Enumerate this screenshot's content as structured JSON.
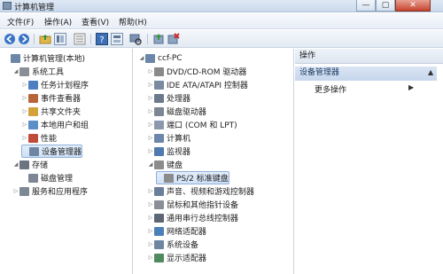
{
  "window": {
    "title": "计算机管理",
    "min": "—",
    "max": "▢",
    "close": "✕"
  },
  "menu": [
    {
      "label": "文件(F)"
    },
    {
      "label": "操作(A)"
    },
    {
      "label": "查看(V)"
    },
    {
      "label": "帮助(H)"
    }
  ],
  "toolbar": {
    "icons": [
      "back-icon",
      "forward-icon",
      "up-folder-icon",
      "show-tree-icon",
      "export-icon",
      "help-icon",
      "properties-icon",
      "scan-hardware-icon",
      "update-driver-icon",
      "uninstall-icon"
    ]
  },
  "left_tree": [
    {
      "label": "计算机管理(本地)",
      "level": 0,
      "expander": "",
      "icon": "computer-icon",
      "color": "#6b86a8"
    },
    {
      "label": "系统工具",
      "level": 1,
      "expander": "◢",
      "icon": "tools-icon",
      "color": "#8a8f96"
    },
    {
      "label": "任务计划程序",
      "level": 2,
      "expander": "▷",
      "icon": "clock-icon",
      "color": "#4e7fc0"
    },
    {
      "label": "事件查看器",
      "level": 2,
      "expander": "▷",
      "icon": "event-viewer-icon",
      "color": "#b8643a"
    },
    {
      "label": "共享文件夹",
      "level": 2,
      "expander": "▷",
      "icon": "shared-folder-icon",
      "color": "#d4a23a"
    },
    {
      "label": "本地用户和组",
      "level": 2,
      "expander": "▷",
      "icon": "users-icon",
      "color": "#5c8fc5"
    },
    {
      "label": "性能",
      "level": 2,
      "expander": "▷",
      "icon": "performance-icon",
      "color": "#c24a3a"
    },
    {
      "label": "设备管理器",
      "level": 2,
      "expander": "",
      "icon": "device-manager-icon",
      "color": "#6f86a3",
      "selected": true
    },
    {
      "label": "存储",
      "level": 1,
      "expander": "◢",
      "icon": "storage-icon",
      "color": "#6b7480"
    },
    {
      "label": "磁盘管理",
      "level": 2,
      "expander": "",
      "icon": "disk-icon",
      "color": "#7c8694"
    },
    {
      "label": "服务和应用程序",
      "level": 1,
      "expander": "▷",
      "icon": "services-icon",
      "color": "#7e8794"
    }
  ],
  "device_tree": [
    {
      "label": "ccf-PC",
      "level": 0,
      "expander": "◢",
      "icon": "computer-icon",
      "color": "#6b86a8"
    },
    {
      "label": "DVD/CD-ROM 驱动器",
      "level": 1,
      "expander": "▷",
      "icon": "dvd-icon",
      "color": "#8a8a8a"
    },
    {
      "label": "IDE ATA/ATAPI 控制器",
      "level": 1,
      "expander": "▷",
      "icon": "ide-icon",
      "color": "#7a8aa0"
    },
    {
      "label": "处理器",
      "level": 1,
      "expander": "▷",
      "icon": "processor-icon",
      "color": "#6a7a8c"
    },
    {
      "label": "磁盘驱动器",
      "level": 1,
      "expander": "▷",
      "icon": "disk-drive-icon",
      "color": "#7c8694"
    },
    {
      "label": "端口 (COM 和 LPT)",
      "level": 1,
      "expander": "▷",
      "icon": "port-icon",
      "color": "#8a9aac"
    },
    {
      "label": "计算机",
      "level": 1,
      "expander": "▷",
      "icon": "computer-icon",
      "color": "#6b86a8"
    },
    {
      "label": "监视器",
      "level": 1,
      "expander": "▷",
      "icon": "monitor-icon",
      "color": "#4f7ab0"
    },
    {
      "label": "键盘",
      "level": 1,
      "expander": "◢",
      "icon": "keyboard-icon",
      "color": "#8c8c8c"
    },
    {
      "label": "PS/2 标准键盘",
      "level": 2,
      "expander": "",
      "icon": "keyboard-icon",
      "color": "#8c8c8c",
      "selected": true
    },
    {
      "label": "声音、视频和游戏控制器",
      "level": 1,
      "expander": "▷",
      "icon": "sound-icon",
      "color": "#6a7f99"
    },
    {
      "label": "鼠标和其他指针设备",
      "level": 1,
      "expander": "▷",
      "icon": "mouse-icon",
      "color": "#8a8f96"
    },
    {
      "label": "通用串行总线控制器",
      "level": 1,
      "expander": "▷",
      "icon": "usb-icon",
      "color": "#5d6773"
    },
    {
      "label": "网络适配器",
      "level": 1,
      "expander": "▷",
      "icon": "network-icon",
      "color": "#4d7fb8"
    },
    {
      "label": "系统设备",
      "level": 1,
      "expander": "▷",
      "icon": "system-device-icon",
      "color": "#6f86a3"
    },
    {
      "label": "显示适配器",
      "level": 1,
      "expander": "▷",
      "icon": "display-adapter-icon",
      "color": "#4f8a5e"
    }
  ],
  "actions": {
    "header": "操作",
    "section": "设备管理器",
    "section_arrow": "▲",
    "more": "更多操作",
    "more_arrow": "▶"
  }
}
